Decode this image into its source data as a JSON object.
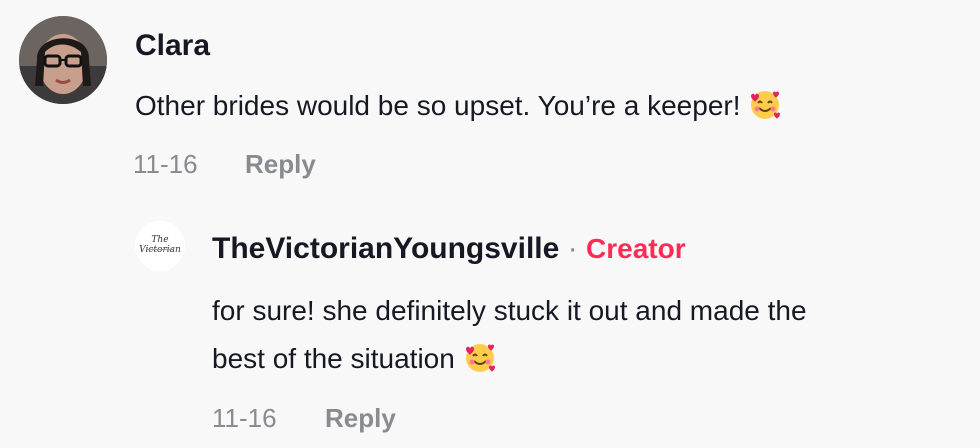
{
  "comments": [
    {
      "username": "Clara",
      "text": "Other brides would be so upset. You’re a keeper!",
      "date": "11-16",
      "reply_label": "Reply",
      "emoji": "smiling-face-with-hearts-icon"
    },
    {
      "username": "TheVictorianYoungsville",
      "separator": "·",
      "badge": "Creator",
      "text_line1": "for sure! she definitely stuck it out and made the",
      "text_line2": "best of the situation",
      "date": "11-16",
      "reply_label": "Reply",
      "avatar_text": "The Victorian",
      "emoji": "smiling-face-with-hearts-icon"
    }
  ],
  "colors": {
    "background": "#f8f8f8",
    "text": "#161823",
    "muted": "#8a8b91",
    "creator": "#fe2c55"
  }
}
